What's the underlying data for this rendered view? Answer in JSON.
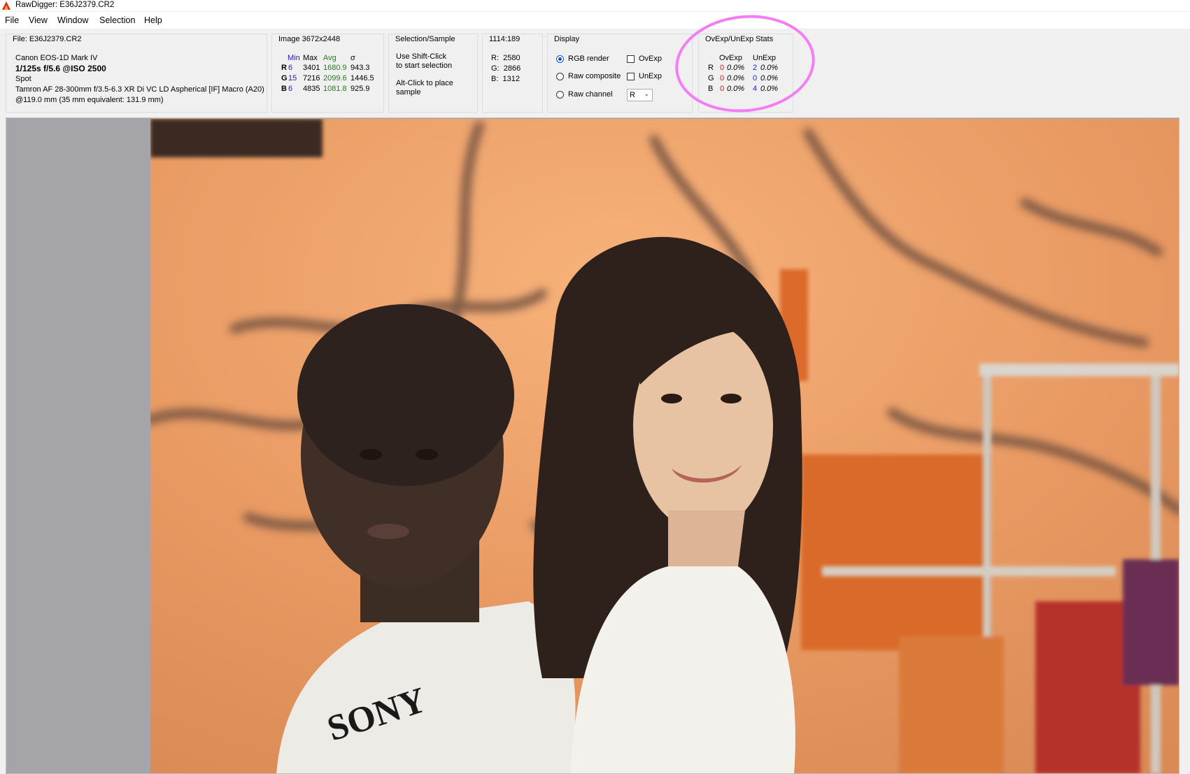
{
  "window": {
    "title": "RawDigger: E36J2379.CR2"
  },
  "menu": [
    "File",
    "View",
    "Window",
    "Selection",
    "Help"
  ],
  "file_panel": {
    "title": "File: E36J2379.CR2",
    "camera": "Canon EOS-1D Mark IV",
    "exposure": "1/125s f/5.6 @ISO 2500",
    "metering": "Spot",
    "lens": "Tamron AF 28-300mm f/3.5-6.3 XR Di VC LD Aspherical [IF] Macro (A20)",
    "focal": "@119.0 mm (35 mm equivalent: 131.9 mm)"
  },
  "image_panel": {
    "title": "Image 3672x2448",
    "headers": {
      "min": "Min",
      "max": "Max",
      "avg": "Avg",
      "sigma": "σ"
    },
    "rows": [
      {
        "ch": "R",
        "min": "6",
        "max": "3401",
        "avg": "1680.9",
        "sigma": "943.3"
      },
      {
        "ch": "G",
        "min": "15",
        "max": "7216",
        "avg": "2099.6",
        "sigma": "1446.5"
      },
      {
        "ch": "B",
        "min": "6",
        "max": "4835",
        "avg": "1081.8",
        "sigma": "925.9"
      }
    ]
  },
  "selection_panel": {
    "title": "Selection/Sample",
    "line1": "Use Shift-Click",
    "line2": "to start selection",
    "line3": "Alt-Click to place",
    "line4": "sample"
  },
  "coord_panel": {
    "title": "1114:189",
    "r": "R:  2580",
    "g": "G:  2866",
    "b": "B:  1312"
  },
  "display_panel": {
    "title": "Display",
    "radio1": "RGB render",
    "radio2": "Raw composite",
    "radio3": "Raw channel",
    "check1": "OvExp",
    "check2": "UnExp",
    "channel_value": "R"
  },
  "stats_panel": {
    "title": "OvExp/UnExp Stats",
    "h_ov": "OvExp",
    "h_un": "UnExp",
    "rows": [
      {
        "ch": "R",
        "ov": "0",
        "ov_pct": "0.0%",
        "un": "2",
        "un_pct": "0.0%"
      },
      {
        "ch": "G",
        "ov": "0",
        "ov_pct": "0.0%",
        "un": "0",
        "un_pct": "0.0%"
      },
      {
        "ch": "B",
        "ov": "0",
        "ov_pct": "0.0%",
        "un": "4",
        "un_pct": "0.0%"
      }
    ]
  },
  "colors": {
    "annotation_ring": "#f47cf4",
    "wall": "#e99a63",
    "radio_selected": "#0a58d0"
  }
}
